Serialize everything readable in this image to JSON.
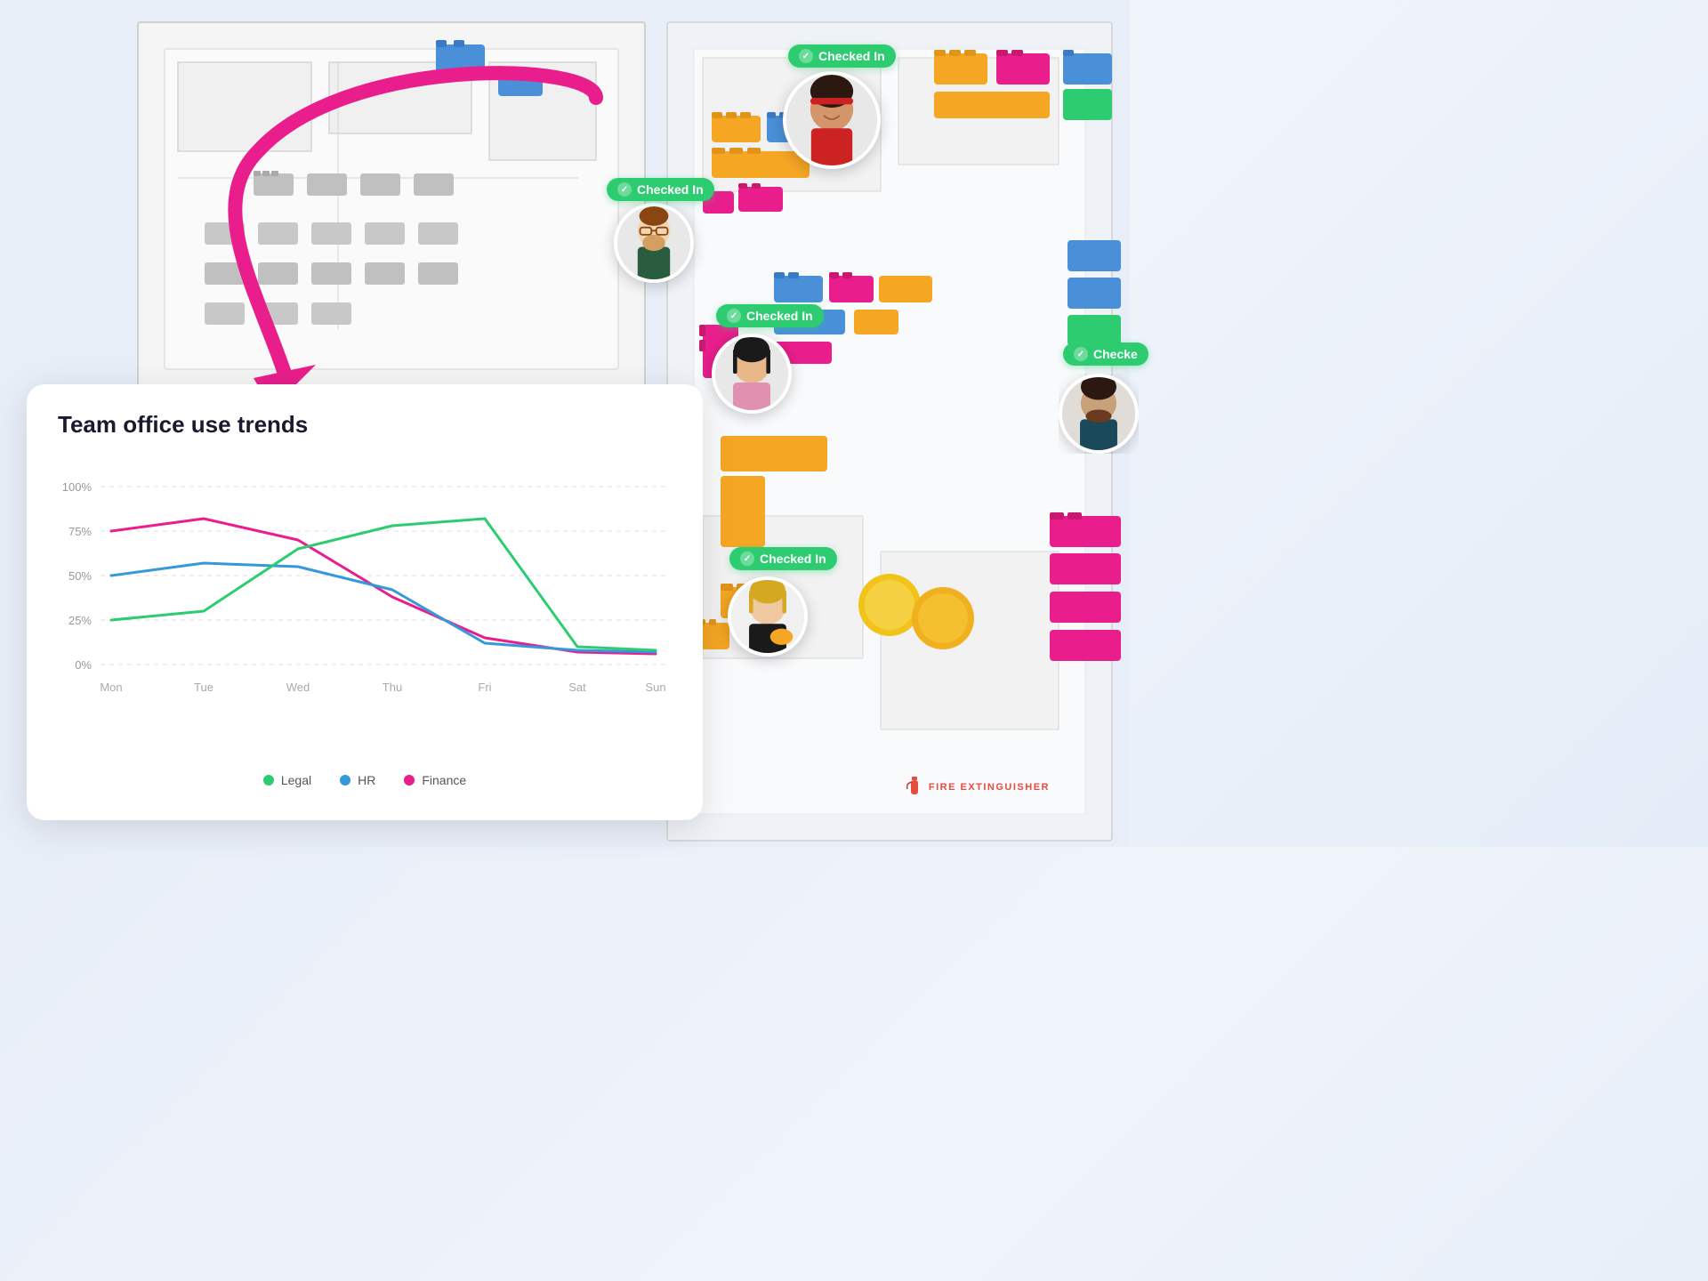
{
  "page": {
    "title": "Team office use trends",
    "background_color": "#e8eef8"
  },
  "chart": {
    "title": "Team office use trends",
    "y_labels": [
      "100%",
      "75%",
      "50%",
      "25%",
      "0%"
    ],
    "x_labels": [
      "Mon",
      "Tue",
      "Wed",
      "Thu",
      "Fri",
      "Sat",
      "Sun"
    ],
    "legend": [
      {
        "label": "Legal",
        "color": "#2ecc71"
      },
      {
        "label": "HR",
        "color": "#3498db"
      },
      {
        "label": "Finance",
        "color": "#e91e8c"
      }
    ],
    "series": {
      "legal": {
        "color": "#2ecc71",
        "points": [
          25,
          30,
          65,
          78,
          82,
          10,
          8
        ]
      },
      "hr": {
        "color": "#3498db",
        "points": [
          50,
          57,
          55,
          42,
          12,
          8,
          7
        ]
      },
      "finance": {
        "color": "#e91e8c",
        "points": [
          75,
          82,
          70,
          38,
          15,
          7,
          6
        ]
      }
    }
  },
  "checked_in_badges": [
    {
      "id": 1,
      "label": "Checked In"
    },
    {
      "id": 2,
      "label": "Checked In"
    },
    {
      "id": 3,
      "label": "Checked In"
    },
    {
      "id": 4,
      "label": "Checked In"
    },
    {
      "id": 5,
      "label": "Checked"
    }
  ],
  "fire_extinguisher": {
    "label": "FIRE EXTINGUISHER"
  },
  "arrow": {
    "color": "#e91e8c",
    "description": "pink curved arrow pointing down-left"
  }
}
